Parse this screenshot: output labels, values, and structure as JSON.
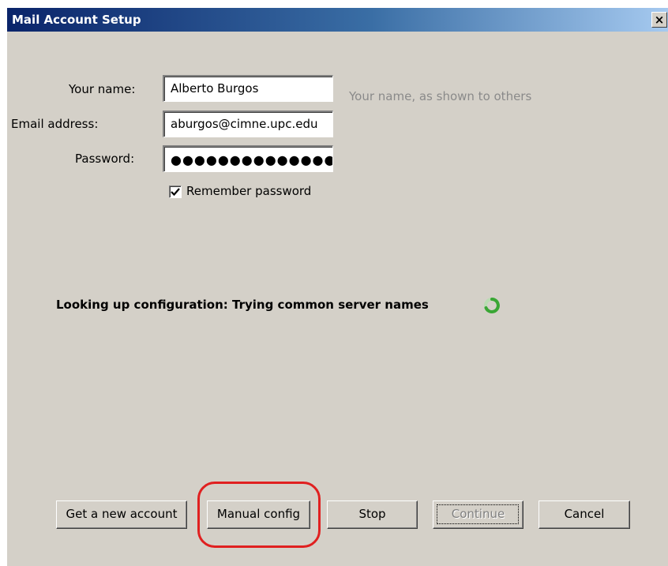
{
  "window": {
    "title": "Mail Account Setup",
    "close_label": "×"
  },
  "form": {
    "name_label": "Your name:",
    "name_value": "Alberto Burgos",
    "name_hint": "Your name, as shown to others",
    "email_label": "Email address:",
    "email_value": "aburgos@cimne.upc.edu",
    "password_label": "Password:",
    "password_value": "●●●●●●●●●●●●●●",
    "remember_label": "Remember password",
    "remember_checked": true
  },
  "status": {
    "text": "Looking up configuration: Trying common server names",
    "spinner_icon": "loading-spinner-icon",
    "spinner_color": "#3aa635"
  },
  "buttons": {
    "get_new_account": "Get a new account",
    "manual_config": "Manual config",
    "stop": "Stop",
    "continue": "Continue",
    "cancel": "Cancel"
  },
  "colors": {
    "titlebar_start": "#0a246a",
    "titlebar_end": "#a6caf0",
    "dialog_bg": "#d4d0c8",
    "annotation_circle": "#e02020"
  }
}
